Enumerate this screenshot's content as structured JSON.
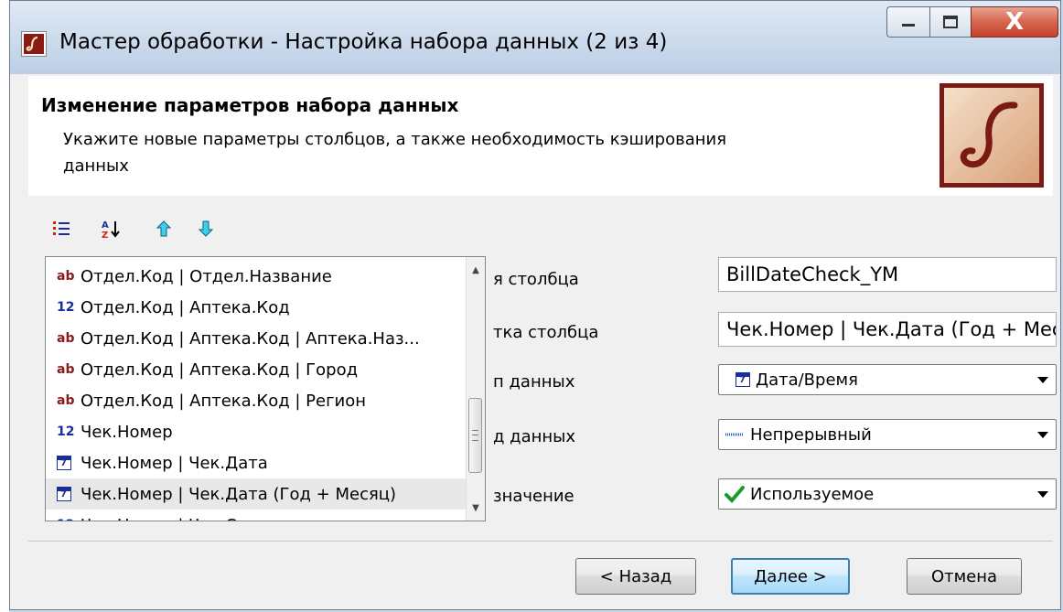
{
  "window": {
    "title": "Мастер обработки - Настройка набора данных (2 из 4)",
    "close_glyph": "X"
  },
  "header": {
    "title": "Изменение параметров набора данных",
    "description": "Укажите новые параметры столбцов, а также необходимость кэширования данных"
  },
  "toolbar": {
    "buttons": [
      "list-numbered-icon",
      "sort-az-icon",
      "move-up-icon",
      "move-down-icon"
    ]
  },
  "columns_list": {
    "items": [
      {
        "type": "ab",
        "type_label": "ab",
        "label": "Отдел.Код | Отдел.Название"
      },
      {
        "type": "num",
        "type_label": "12",
        "label": "Отдел.Код | Аптека.Код"
      },
      {
        "type": "ab",
        "type_label": "ab",
        "label": "Отдел.Код | Аптека.Код | Аптека.Наз..."
      },
      {
        "type": "ab",
        "type_label": "ab",
        "label": "Отдел.Код | Аптека.Код | Город"
      },
      {
        "type": "ab",
        "type_label": "ab",
        "label": "Отдел.Код | Аптека.Код | Регион"
      },
      {
        "type": "num",
        "type_label": "12",
        "label": "Чек.Номер"
      },
      {
        "type": "date",
        "type_label": "",
        "label": "Чек.Номер | Чек.Дата"
      },
      {
        "type": "date",
        "type_label": "",
        "label": "Чек.Номер | Чек.Дата (Год + Месяц)",
        "selected": true
      },
      {
        "type": "num",
        "type_label": "12",
        "label": "Чек.Номер | Чек.Скидка"
      }
    ]
  },
  "properties": {
    "column_name_label": "я столбца",
    "column_name_value": "BillDateCheck_YM",
    "column_caption_label": "тка столбца",
    "column_caption_value": "Чек.Номер | Чек.Дата (Год + Месяц)",
    "data_type_label": "п данных",
    "data_type_value": "Дата/Время",
    "data_kind_label": "д данных",
    "data_kind_value": "Непрерывный",
    "purpose_label": "значение",
    "purpose_value": "Используемое"
  },
  "buttons": {
    "back": "< Назад",
    "next": "Далее >",
    "cancel": "Отмена"
  },
  "colors": {
    "accent_blue": "#3c7fb1",
    "type_ab": "#8b1a1a",
    "type_num": "#1b2d99",
    "logo_bg": "#7a1a14"
  }
}
